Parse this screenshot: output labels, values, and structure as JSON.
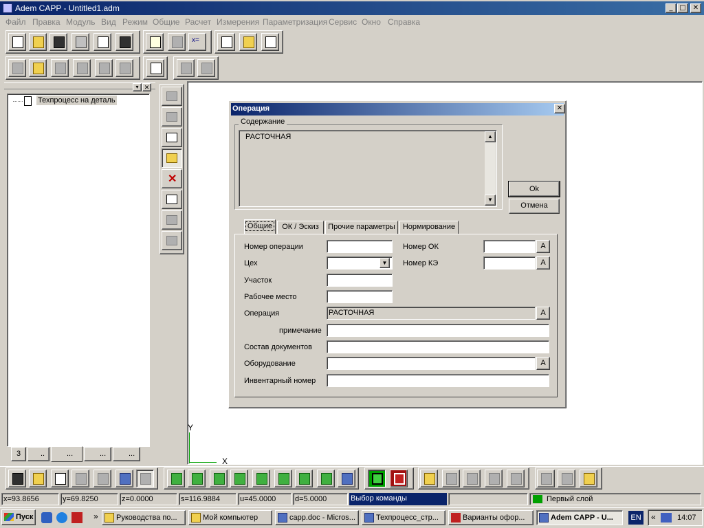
{
  "window": {
    "title": "Adem CAPP - Untitled1.adm",
    "controls": [
      "_",
      "□",
      "✕"
    ]
  },
  "menu": [
    "Файл",
    "Правка",
    "Модуль",
    "Вид",
    "Режим",
    "Общие",
    "Расчет",
    "Измерения",
    "Параметризация",
    "Сервис",
    "Окно",
    "Справка"
  ],
  "toolbar1": {
    "formula_icon": "x="
  },
  "tree": {
    "root_label": "Техпроцесс на деталь"
  },
  "panel_tabs": [
    "3",
    "..",
    "...",
    "...",
    "..."
  ],
  "canvas": {
    "axis_y": "Y",
    "axis_x": "X"
  },
  "dialog": {
    "title": "Операция",
    "close": "✕",
    "content_group": "Содержание",
    "content_text": "РАСТОЧНАЯ",
    "ok": "Ok",
    "cancel": "Отмена",
    "tabs": [
      "Общие",
      "ОК / Эскиз",
      "Прочие параметры",
      "Нормирование"
    ],
    "labels": {
      "op_number": "Номер операции",
      "ok_number": "Номер ОК",
      "shop": "Цех",
      "ke_number": "Номер КЭ",
      "section": "Участок",
      "workplace": "Рабочее место",
      "operation": "Операция",
      "note": "примечание",
      "docs": "Состав документов",
      "equipment": "Оборудование",
      "inventory": "Инвентарный номер"
    },
    "values": {
      "operation": "РАСТОЧНАЯ"
    },
    "a_button": "A",
    "combo_arrow": "▼"
  },
  "status": {
    "x": "x=93.8656",
    "y": "y=69.8250",
    "z": "z=0.0000",
    "s": "s=116.9884",
    "u": "u=45.0000",
    "d": "d=5.0000",
    "mode": "Выбор команды",
    "layer": "Первый слой"
  },
  "taskbar": {
    "start": "Пуск",
    "items": [
      "Руководства по...",
      "Мой компьютер",
      "capp.doc - Micros...",
      "Техпроцесс_стр...",
      "Варианты офор...",
      "Adem CAPP - U..."
    ],
    "lang": "EN",
    "time": "14:07",
    "chevron": "»",
    "tray_chevron": "«"
  },
  "colors": {
    "titlebar": "#0a246a",
    "dialog_title_end": "#a6caf0",
    "status_mode_bg": "#0a246a",
    "layer_color": "#00a000"
  }
}
